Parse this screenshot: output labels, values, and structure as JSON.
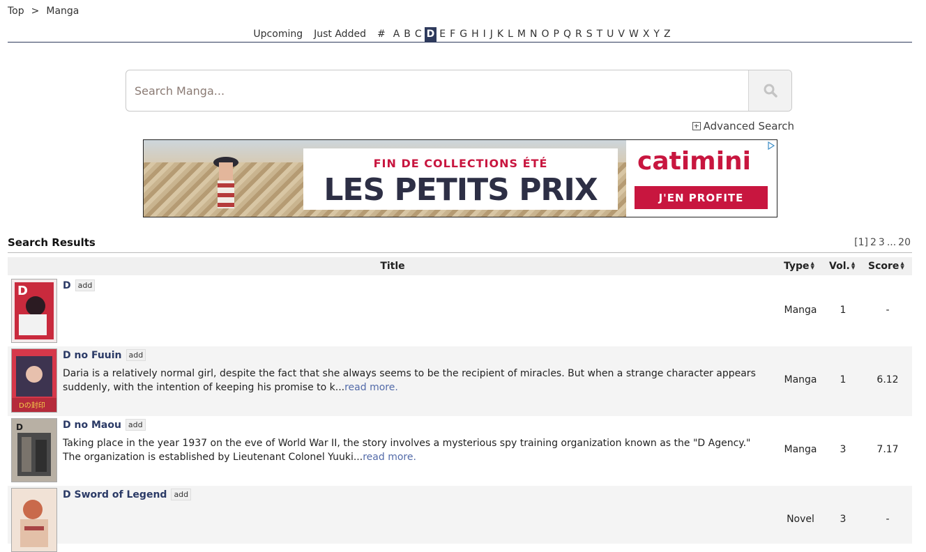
{
  "breadcrumb": {
    "top": "Top",
    "separator": ">",
    "current": "Manga"
  },
  "letter_nav": {
    "words": [
      "Upcoming",
      "Just Added",
      "#"
    ],
    "letters": [
      "A",
      "B",
      "C",
      "D",
      "E",
      "F",
      "G",
      "H",
      "I",
      "J",
      "K",
      "L",
      "M",
      "N",
      "O",
      "P",
      "Q",
      "R",
      "S",
      "T",
      "U",
      "V",
      "W",
      "X",
      "Y",
      "Z"
    ],
    "active": "D"
  },
  "search": {
    "placeholder": "Search Manga...",
    "icon": "search-icon",
    "advanced_label": "Advanced Search"
  },
  "ad": {
    "line1": "FIN DE COLLECTIONS ÉTÉ",
    "line2": "LES PETITS PRIX",
    "brand": "catimini",
    "cta": "J'EN PROFITE"
  },
  "results": {
    "title": "Search Results",
    "pager": {
      "current": "[1]",
      "pages": [
        "2",
        "3",
        "...",
        "20"
      ]
    },
    "headers": {
      "title": "Title",
      "type": "Type",
      "vol": "Vol.",
      "score": "Score"
    },
    "rows": [
      {
        "title": "D",
        "add": "add",
        "synopsis": "",
        "read_more": "",
        "type": "Manga",
        "vol": "1",
        "score": "-"
      },
      {
        "title": "D no Fuuin",
        "add": "add",
        "synopsis": "Daria is a relatively normal girl, despite the fact that she always seems to be the recipient of miracles. But when a strange character appears suddenly, with the intention of keeping his promise to k...",
        "read_more": "read more.",
        "type": "Manga",
        "vol": "1",
        "score": "6.12"
      },
      {
        "title": "D no Maou",
        "add": "add",
        "synopsis": "Taking place in the year 1937 on the eve of World War II, the story involves a mysterious spy training organization known as the \"D Agency.\" The organization is established by Lieutenant Colonel Yuuki...",
        "read_more": "read more.",
        "type": "Manga",
        "vol": "3",
        "score": "7.17"
      },
      {
        "title": "D Sword of Legend",
        "add": "add",
        "synopsis": "",
        "read_more": "",
        "type": "Novel",
        "vol": "3",
        "score": "-"
      }
    ]
  },
  "colors": {
    "accent": "#2e3a5c",
    "link": "#2b3a66",
    "ad_red": "#c8163f"
  }
}
